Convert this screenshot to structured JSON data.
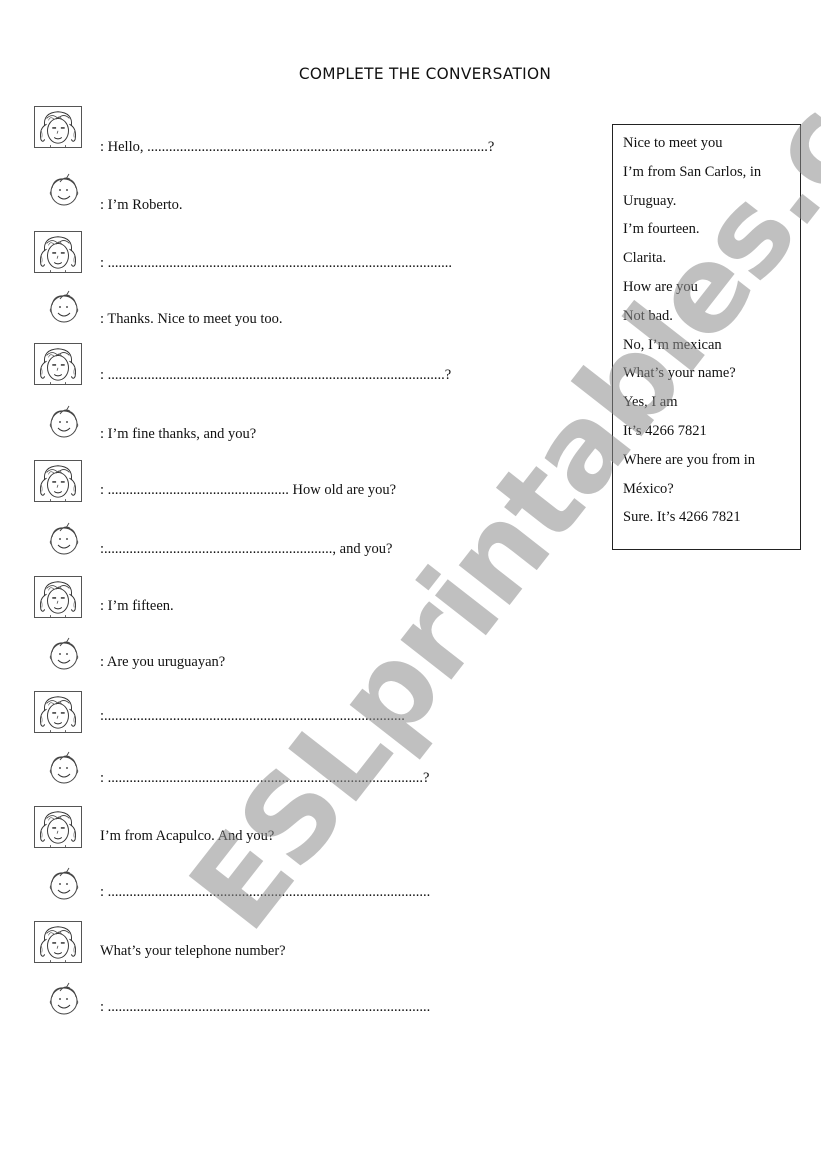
{
  "title": "COMPLETE THE CONVERSATION",
  "conversation": [
    {
      "speaker": "girl",
      "text": ": Hello, ..............................................................................................?"
    },
    {
      "speaker": "boy",
      "text": ": I’m Roberto."
    },
    {
      "speaker": "girl",
      "text": ": ..............................................................................................."
    },
    {
      "speaker": "boy",
      "text": ": Thanks. Nice to meet you too."
    },
    {
      "speaker": "girl",
      "text": ": .............................................................................................?"
    },
    {
      "speaker": "boy",
      "text": ": I’m fine thanks, and you?"
    },
    {
      "speaker": "girl",
      "text": ": .................................................. How old are you?"
    },
    {
      "speaker": "boy",
      "text": ":..............................................................., and you?"
    },
    {
      "speaker": "girl",
      "text": ": I’m fifteen."
    },
    {
      "speaker": "boy",
      "text": ": Are you uruguayan?"
    },
    {
      "speaker": "girl",
      "text": ":..................................................................................."
    },
    {
      "speaker": "boy",
      "text": ": .......................................................................................?"
    },
    {
      "speaker": "girl",
      "text": "I’m from Acapulco. And you?"
    },
    {
      "speaker": "boy",
      "text": ": ........................................................................................."
    },
    {
      "speaker": "girl",
      "text": "What’s your telephone number?"
    },
    {
      "speaker": "boy",
      "text": ": ........................................................................................."
    }
  ],
  "word_box": [
    "Nice to meet you",
    "I’m from San Carlos, in",
    "Uruguay.",
    "I’m fourteen.",
    "Clarita.",
    "How are you",
    "Not bad.",
    "No, I’m mexican",
    "What’s your name?",
    "Yes, I am",
    "It’s 4266 7821",
    "Where are you from in",
    "México?",
    "Sure. It’s 4266 7821"
  ],
  "watermark": "ESLprintables.com"
}
